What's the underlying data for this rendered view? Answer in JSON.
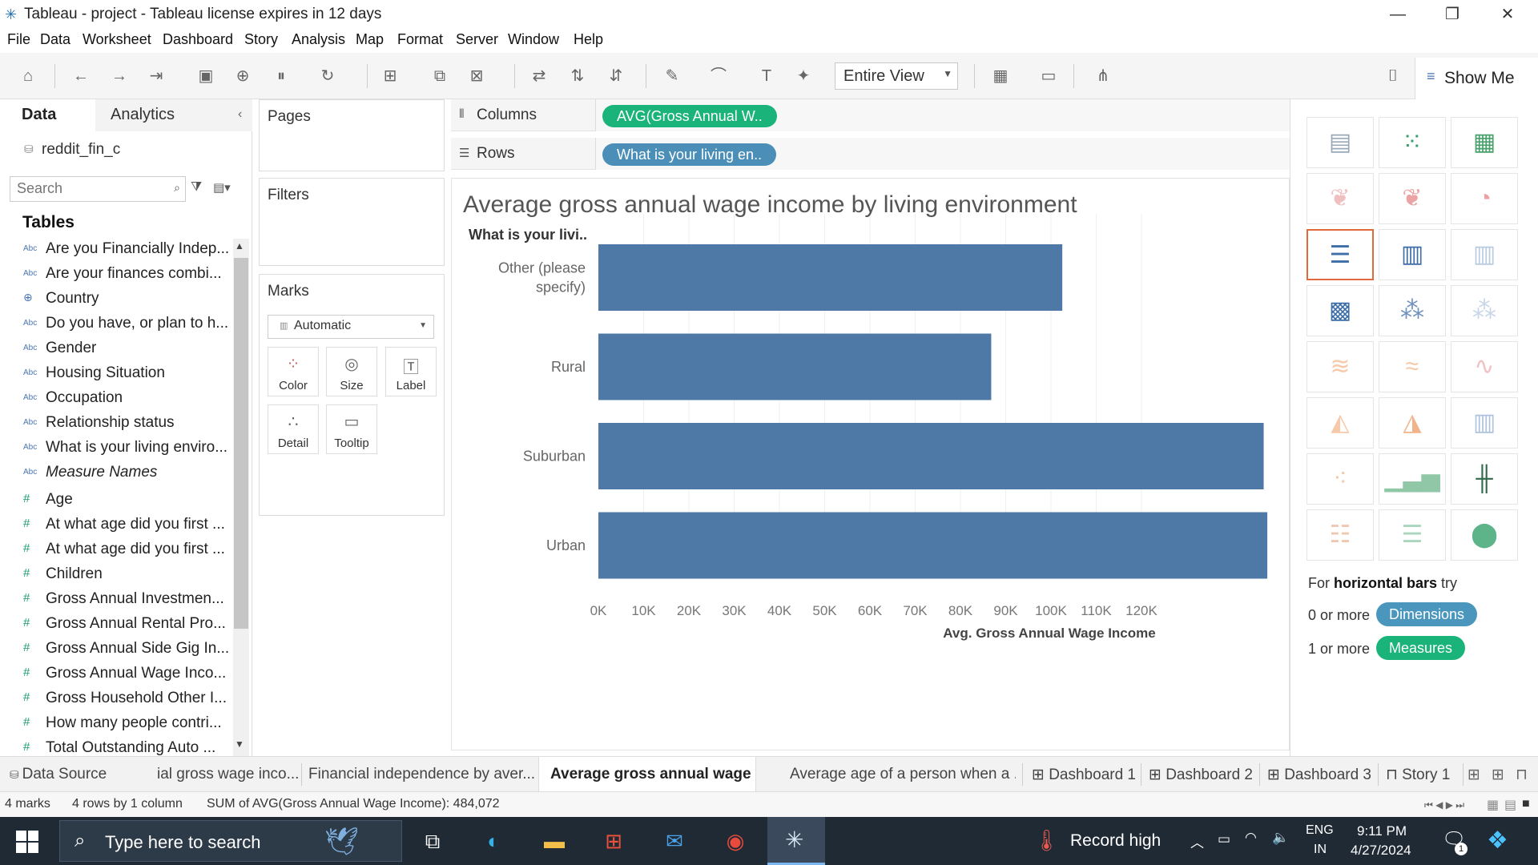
{
  "window": {
    "title": "Tableau - project - Tableau license expires in 12 days",
    "minimize": "—",
    "restore": "❐",
    "close": "✕"
  },
  "menu": [
    "File",
    "Data",
    "Worksheet",
    "Dashboard",
    "Story",
    "Analysis",
    "Map",
    "Format",
    "Server",
    "Window",
    "Help"
  ],
  "toolbar": {
    "fit_label": "Entire View",
    "show_me_label": "Show Me"
  },
  "data_pane": {
    "tab_data": "Data",
    "tab_analytics": "Analytics",
    "datasource": "reddit_fin_c",
    "search_placeholder": "Search",
    "tables_header": "Tables",
    "dimensions": [
      {
        "type": "Abc",
        "name": "Are you Financially Indep..."
      },
      {
        "type": "Abc",
        "name": "Are your finances combi..."
      },
      {
        "type": "⊕",
        "name": "Country"
      },
      {
        "type": "Abc",
        "name": "Do you have, or plan to h..."
      },
      {
        "type": "Abc",
        "name": "Gender"
      },
      {
        "type": "Abc",
        "name": "Housing Situation"
      },
      {
        "type": "Abc",
        "name": "Occupation"
      },
      {
        "type": "Abc",
        "name": "Relationship status"
      },
      {
        "type": "Abc",
        "name": "What is your living enviro..."
      },
      {
        "type": "Abc",
        "name": "Measure Names"
      }
    ],
    "measures": [
      {
        "type": "#",
        "name": "Age"
      },
      {
        "type": "#",
        "name": "At what age did you first ..."
      },
      {
        "type": "#",
        "name": "At what age did you first ..."
      },
      {
        "type": "#",
        "name": "Children"
      },
      {
        "type": "#",
        "name": "Gross Annual Investmen..."
      },
      {
        "type": "#",
        "name": "Gross Annual Rental Pro..."
      },
      {
        "type": "#",
        "name": "Gross Annual Side Gig In..."
      },
      {
        "type": "#",
        "name": "Gross Annual Wage Inco..."
      },
      {
        "type": "#",
        "name": "Gross Household Other I..."
      },
      {
        "type": "#",
        "name": "How many people contri..."
      },
      {
        "type": "#",
        "name": "Total Outstanding Auto ..."
      }
    ]
  },
  "cards": {
    "pages": "Pages",
    "filters": "Filters",
    "marks": "Marks",
    "mark_type": "Automatic",
    "mark_buttons": [
      "Color",
      "Size",
      "Label",
      "Detail",
      "Tooltip"
    ]
  },
  "shelves": {
    "columns_label": "Columns",
    "rows_label": "Rows",
    "columns_pill": "AVG(Gross Annual W..",
    "rows_pill": "What is your living en.."
  },
  "viz": {
    "title": "Average gross annual wage income by living environment",
    "row_header": "What is your livi..",
    "bar_color": "#4e79a7"
  },
  "chart_data": {
    "type": "bar",
    "orientation": "horizontal",
    "title": "Average gross annual wage income by living environment",
    "categories": [
      "Other (please specify)",
      "Rural",
      "Suburban",
      "Urban"
    ],
    "values": [
      102500,
      86800,
      147000,
      147800
    ],
    "xlabel": "Avg. Gross Annual Wage Income",
    "ylabel": "What is your livi..",
    "xlim": [
      0,
      125000
    ],
    "xticks": [
      "0K",
      "10K",
      "20K",
      "30K",
      "40K",
      "50K",
      "60K",
      "70K",
      "80K",
      "90K",
      "100K",
      "110K",
      "120K"
    ],
    "grid": true
  },
  "show_me": {
    "hint_prefix": "For",
    "hint_bold": "horizontal bars",
    "hint_suffix": "try",
    "dim_prefix": "0 or more",
    "dim_pill": "Dimensions",
    "meas_prefix": "1 or more",
    "meas_pill": "Measures"
  },
  "tabs": {
    "data_source": "Data Source",
    "sheets": [
      "ial gross wage inco...",
      "Financial independence by aver...",
      "Average gross annual wage inc...",
      "Average age of a person when a ...",
      "Dashboard 1",
      "Dashboard 2",
      "Dashboard 3",
      "Story 1"
    ]
  },
  "status": {
    "marks": "4 marks",
    "dims": "4 rows by 1 column",
    "sum": "SUM of AVG(Gross Annual Wage Income): 484,072"
  },
  "taskbar": {
    "search_placeholder": "Type here to search",
    "weather": "Record high",
    "lang_top": "ENG",
    "lang_bottom": "IN",
    "time": "9:11 PM",
    "date": "4/27/2024",
    "notif_count": "1"
  }
}
